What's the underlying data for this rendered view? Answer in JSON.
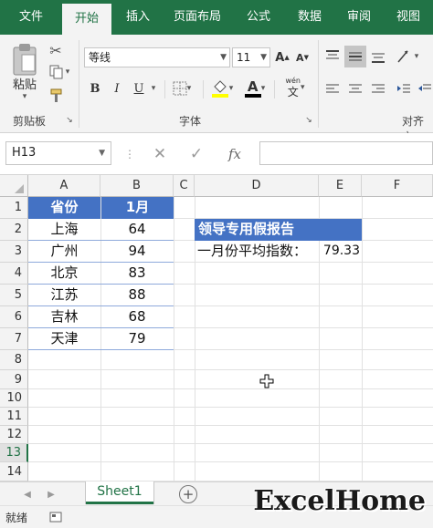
{
  "ribbon_tabs": [
    "文件",
    "开始",
    "插入",
    "页面布局",
    "公式",
    "数据",
    "审阅",
    "视图"
  ],
  "ribbon": {
    "paste_label": "粘贴",
    "clipboard_label": "剪贴板",
    "font_name": "等线",
    "font_size": "11",
    "font_group_label": "字体",
    "align_group_label": "对齐方",
    "bold": "B",
    "italic": "I",
    "underline": "U",
    "grow_font": "A",
    "shrink_font": "A",
    "font_color_letter": "A",
    "phonetic_letter": "文",
    "phonetic_top": "wén"
  },
  "formula_bar": {
    "name_box": "H13",
    "fx": "fx",
    "formula": ""
  },
  "columns": [
    "A",
    "B",
    "C",
    "D",
    "E",
    "F"
  ],
  "rows": [
    "1",
    "2",
    "3",
    "4",
    "5",
    "6",
    "7",
    "8",
    "9",
    "10",
    "11",
    "12",
    "13",
    "14"
  ],
  "selected_row": "13",
  "table": {
    "headers": [
      "省份",
      "1月"
    ],
    "rows": [
      [
        "上海",
        "64"
      ],
      [
        "广州",
        "94"
      ],
      [
        "北京",
        "83"
      ],
      [
        "江苏",
        "88"
      ],
      [
        "吉林",
        "68"
      ],
      [
        "天津",
        "79"
      ]
    ]
  },
  "report": {
    "title": "领导专用假报告",
    "label": "一月份平均指数：",
    "value": "79.33"
  },
  "sheet_tab": "Sheet1",
  "status_text": "就绪",
  "watermark": "ExcelHome",
  "colors": {
    "ribbon_green": "#217346",
    "table_header_blue": "#4472c4",
    "table_border": "#8ea9db"
  }
}
